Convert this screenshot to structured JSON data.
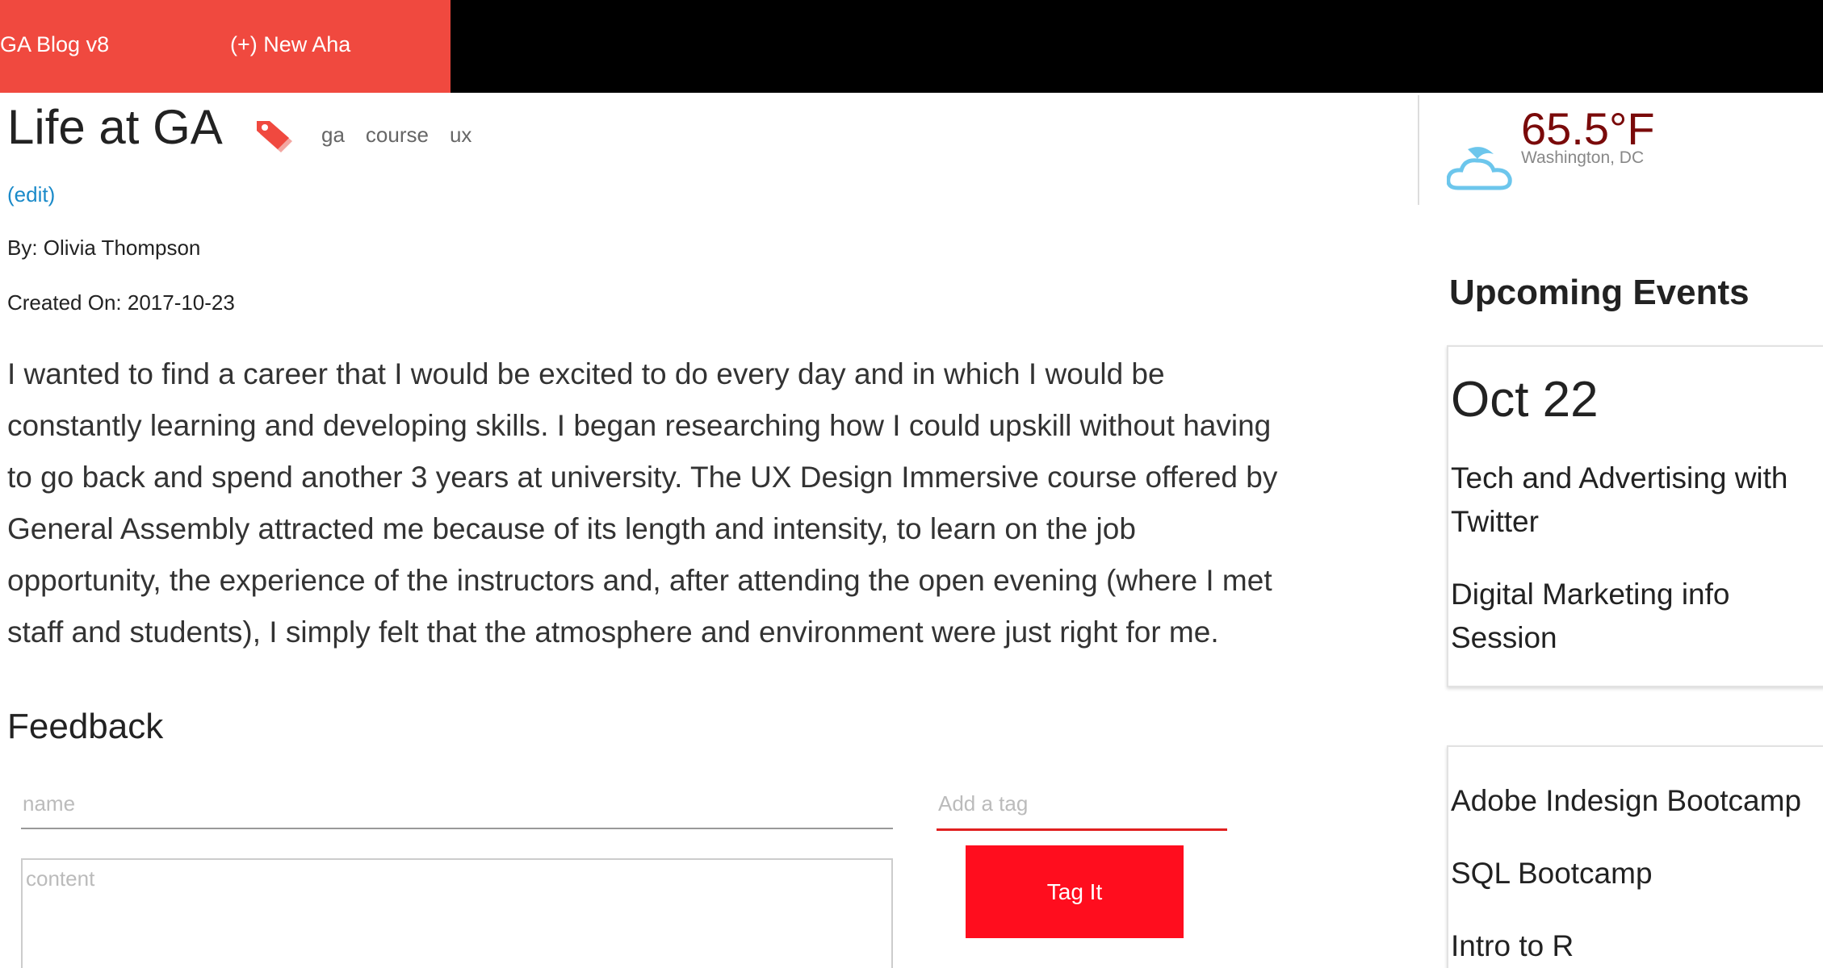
{
  "nav": {
    "brand": "GA Blog v8",
    "new_post": "(+) New Aha"
  },
  "article": {
    "title": "Life at GA",
    "tags": [
      "ga",
      "course",
      "ux"
    ],
    "edit_label": "(edit)",
    "author": "By: Olivia Thompson",
    "created": "Created On: 2017-10-23",
    "body_lines": [
      "I wanted to find a career that I would be excited to do every day and in which I would be",
      "constantly learning and developing skills. I began researching how I could upskill without having",
      "to go back and spend another 3 years at university. The UX Design Immersive course offered by",
      "General Assembly attracted me because of its length and intensity, to learn on the job",
      "opportunity, the experience of the instructors and, after attending the open evening (where I met",
      "staff and students), I simply felt that the atmosphere and environment were just right for me."
    ]
  },
  "feedback": {
    "heading": "Feedback",
    "name_placeholder": "name",
    "content_placeholder": "content",
    "tag_placeholder": "Add a tag",
    "tag_button": "Tag It"
  },
  "weather": {
    "temperature": "65.5°F",
    "location": "Washington, DC",
    "icon": "cloud-icon"
  },
  "events": {
    "heading": "Upcoming Events",
    "cards": [
      {
        "date": "Oct 22",
        "titles": [
          "Tech and Advertising with Twitter",
          "Digital Marketing info Session"
        ]
      },
      {
        "titles": [
          "Adobe Indesign Bootcamp",
          "SQL Bootcamp",
          "Intro to R"
        ]
      }
    ]
  },
  "colors": {
    "nav_accent": "#f0493f",
    "button_red": "#ff0d1e",
    "link_blue": "#1a8ac9",
    "temperature": "#7a0a0a"
  }
}
